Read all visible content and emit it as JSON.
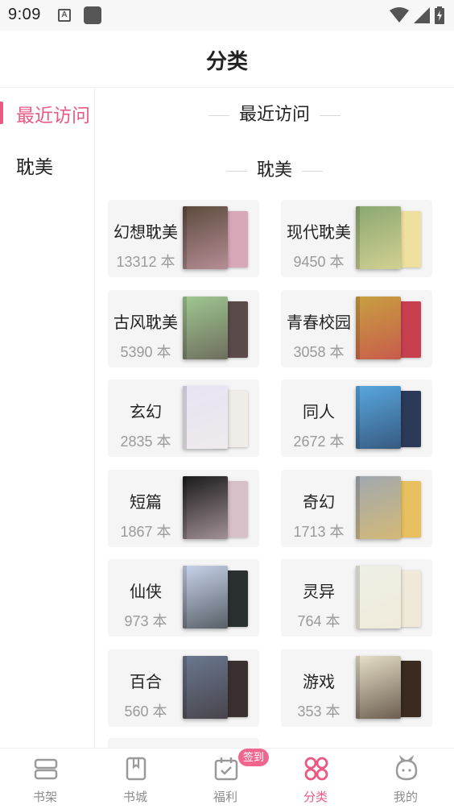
{
  "status_bar": {
    "time": "9:09",
    "a_icon_text": "A"
  },
  "header": {
    "title": "分类"
  },
  "sidebar": {
    "items": [
      {
        "label": "最近访问",
        "active": true
      },
      {
        "label": "耽美",
        "active": false
      }
    ]
  },
  "main": {
    "section_recent": "最近访问",
    "section_danmei": "耽美",
    "categories": [
      {
        "name": "幻想耽美",
        "count": "13312 本",
        "cover_front": "#5c4a3d",
        "cover_back": "#d8a8b8"
      },
      {
        "name": "现代耽美",
        "count": "9450 本",
        "cover_front": "#8aa870",
        "cover_back": "#efe0a0"
      },
      {
        "name": "古风耽美",
        "count": "5390 本",
        "cover_front": "#9fc890",
        "cover_back": "#5a4a4a"
      },
      {
        "name": "青春校园",
        "count": "3058 本",
        "cover_front": "#c8a040",
        "cover_back": "#c84050"
      },
      {
        "name": "玄幻",
        "count": "2835 本",
        "cover_front": "#e8e4f4",
        "cover_back": "#f0ece8"
      },
      {
        "name": "同人",
        "count": "2672 本",
        "cover_front": "#58a8e0",
        "cover_back": "#2a3a58"
      },
      {
        "name": "短篇",
        "count": "1867 本",
        "cover_front": "#1a1a1a",
        "cover_back": "#d8c0c8"
      },
      {
        "name": "奇幻",
        "count": "1713 本",
        "cover_front": "#a0a8b0",
        "cover_back": "#e8c060"
      },
      {
        "name": "仙侠",
        "count": "973 本",
        "cover_front": "#c8d4ec",
        "cover_back": "#2a3030"
      },
      {
        "name": "灵异",
        "count": "764 本",
        "cover_front": "#eef0e4",
        "cover_back": "#f0e8d8"
      },
      {
        "name": "百合",
        "count": "560 本",
        "cover_front": "#6a7890",
        "cover_back": "#3a3030"
      },
      {
        "name": "游戏",
        "count": "353 本",
        "cover_front": "#e8e0c8",
        "cover_back": "#3a2a20"
      }
    ]
  },
  "bottom_nav": {
    "items": [
      {
        "label": "书架",
        "icon": "bookshelf-icon"
      },
      {
        "label": "书城",
        "icon": "bookstore-icon"
      },
      {
        "label": "福利",
        "icon": "calendar-check-icon"
      },
      {
        "label": "分类",
        "icon": "grid-icon",
        "active": true
      },
      {
        "label": "我的",
        "icon": "profile-icon"
      }
    ],
    "sign_badge": "签到"
  },
  "colors": {
    "accent": "#e85a84",
    "badge": "#f0668f",
    "card_bg": "#f5f5f5",
    "muted_text": "#9a9a9a"
  }
}
